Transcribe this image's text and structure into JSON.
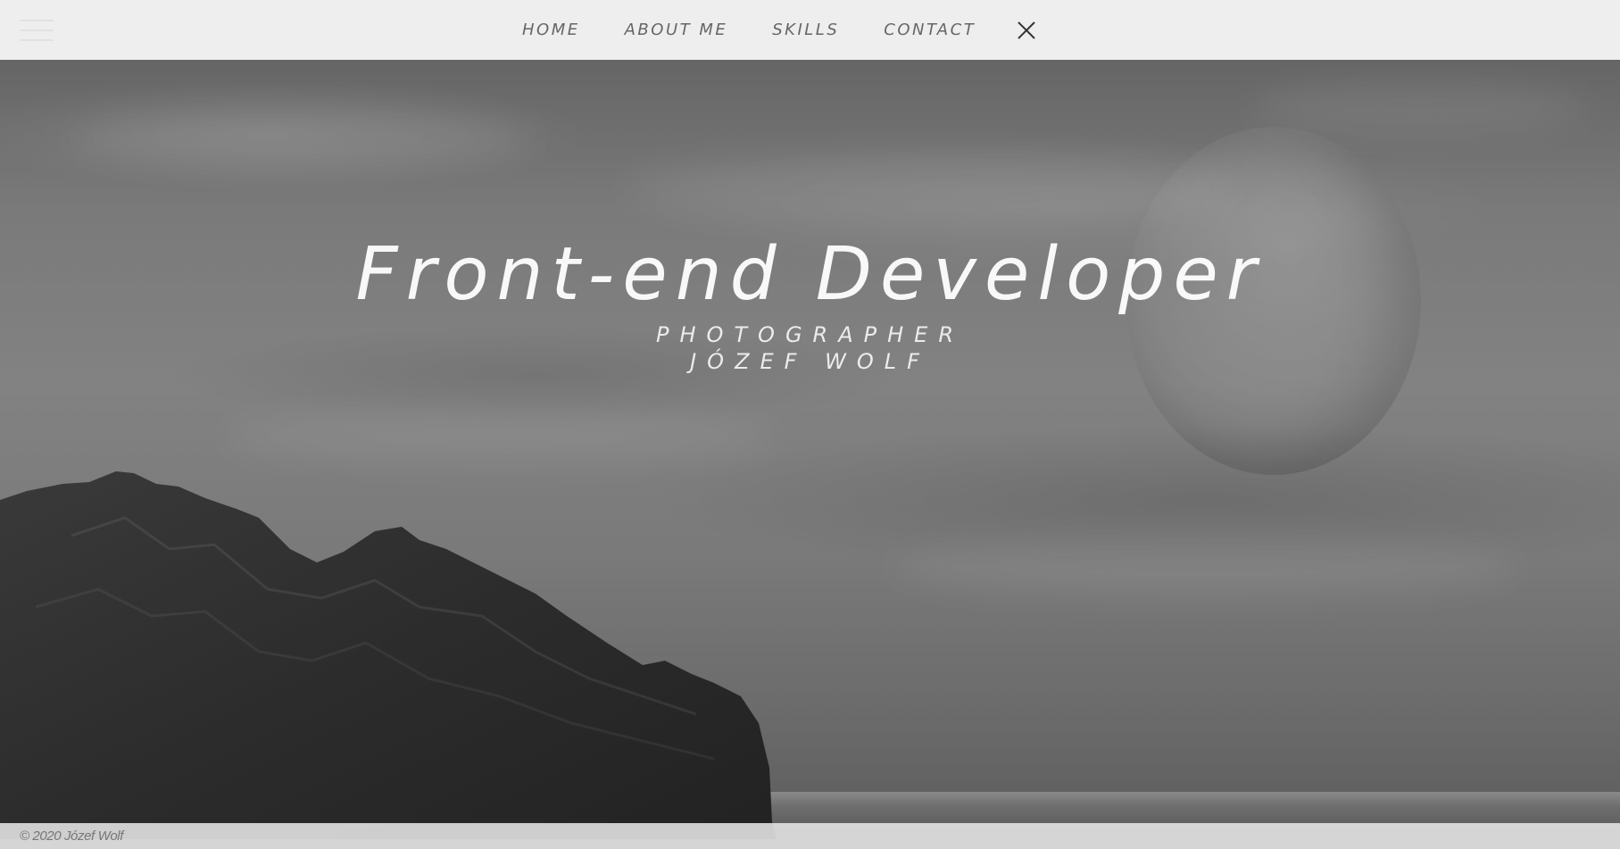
{
  "nav": {
    "items": [
      {
        "label": "HOME"
      },
      {
        "label": "ABOUT ME"
      },
      {
        "label": "SKILLS"
      },
      {
        "label": "CONTACT"
      }
    ],
    "menu_icon": "hamburger-icon",
    "close_icon": "close-icon"
  },
  "hero": {
    "title": "Front-end Developer",
    "subtitle_1": "PHOTOGRAPHER",
    "subtitle_2": "JÓZEF WOLF"
  },
  "footer": {
    "copyright": "© 2020 Józef Wolf"
  },
  "colors": {
    "navbar_bg": "#eeeeee",
    "nav_text": "#666666",
    "hero_text": "#ffffff",
    "footer_bg": "#e6e6e6"
  }
}
